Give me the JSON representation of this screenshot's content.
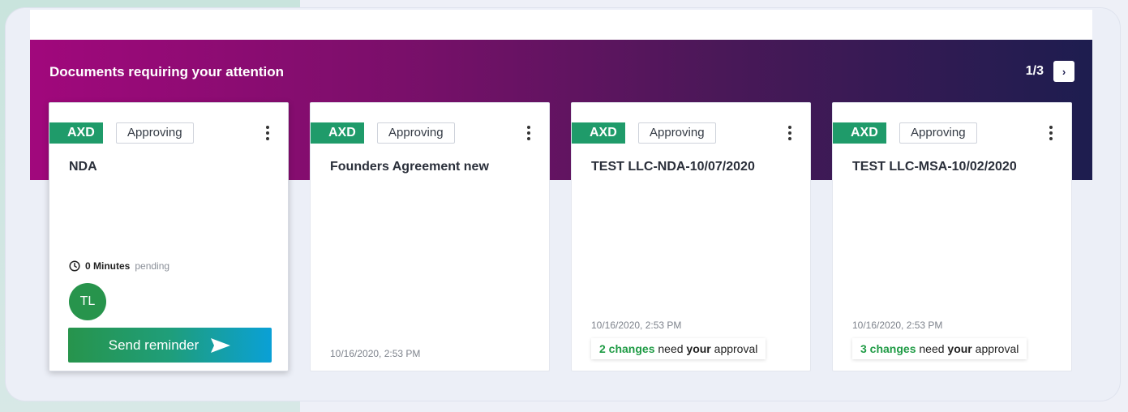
{
  "banner": {
    "title": "Documents requiring your attention",
    "pager": "1/3",
    "next_glyph": "›"
  },
  "cards": [
    {
      "tag": "AXD",
      "status": "Approving",
      "title": "NDA",
      "pending_value": "0 Minutes",
      "pending_label": "pending",
      "avatar_initials": "TL",
      "reminder_label": "Send reminder"
    },
    {
      "tag": "AXD",
      "status": "Approving",
      "title": "Founders Agreement new",
      "timestamp": "10/16/2020, 2:53 PM"
    },
    {
      "tag": "AXD",
      "status": "Approving",
      "title": "TEST LLC-NDA-10/07/2020",
      "timestamp": "10/16/2020, 2:53 PM",
      "changes_count": "2 changes",
      "changes_need": "need",
      "changes_your": "your",
      "changes_approval": "approval"
    },
    {
      "tag": "AXD",
      "status": "Approving",
      "title": "TEST LLC-MSA-10/02/2020",
      "timestamp": "10/16/2020, 2:53 PM",
      "changes_count": "3 changes",
      "changes_need": "need",
      "changes_your": "your",
      "changes_approval": "approval"
    }
  ],
  "colors": {
    "tag": "#1f9b6a",
    "avatar": "#27944c",
    "banner_start": "#a1087c",
    "banner_end": "#1d1d4f"
  }
}
